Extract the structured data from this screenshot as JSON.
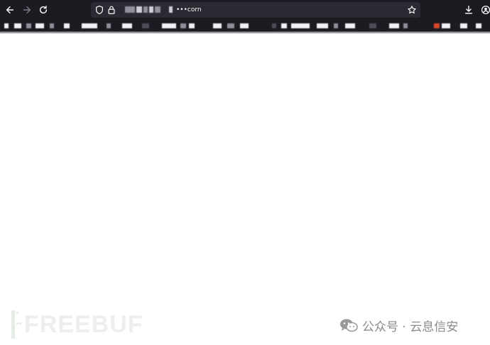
{
  "browser": {
    "url_suffix": "•••corn"
  },
  "icons": {
    "back": "arrow-left-icon",
    "forward": "arrow-right-icon",
    "reload": "reload-icon",
    "shield": "tracking-shield-icon",
    "lock": "lock-icon",
    "bookmark_star": "star-icon",
    "downloads": "download-icon",
    "account": "account-icon"
  },
  "watermark": {
    "brand": "FREEBUF",
    "wechat_account": "公众号 · 云息信安"
  },
  "colors": {
    "chrome_bg": "#1c1b22",
    "urlbar_bg": "#2b2a33",
    "page_bg": "#ffffff"
  }
}
